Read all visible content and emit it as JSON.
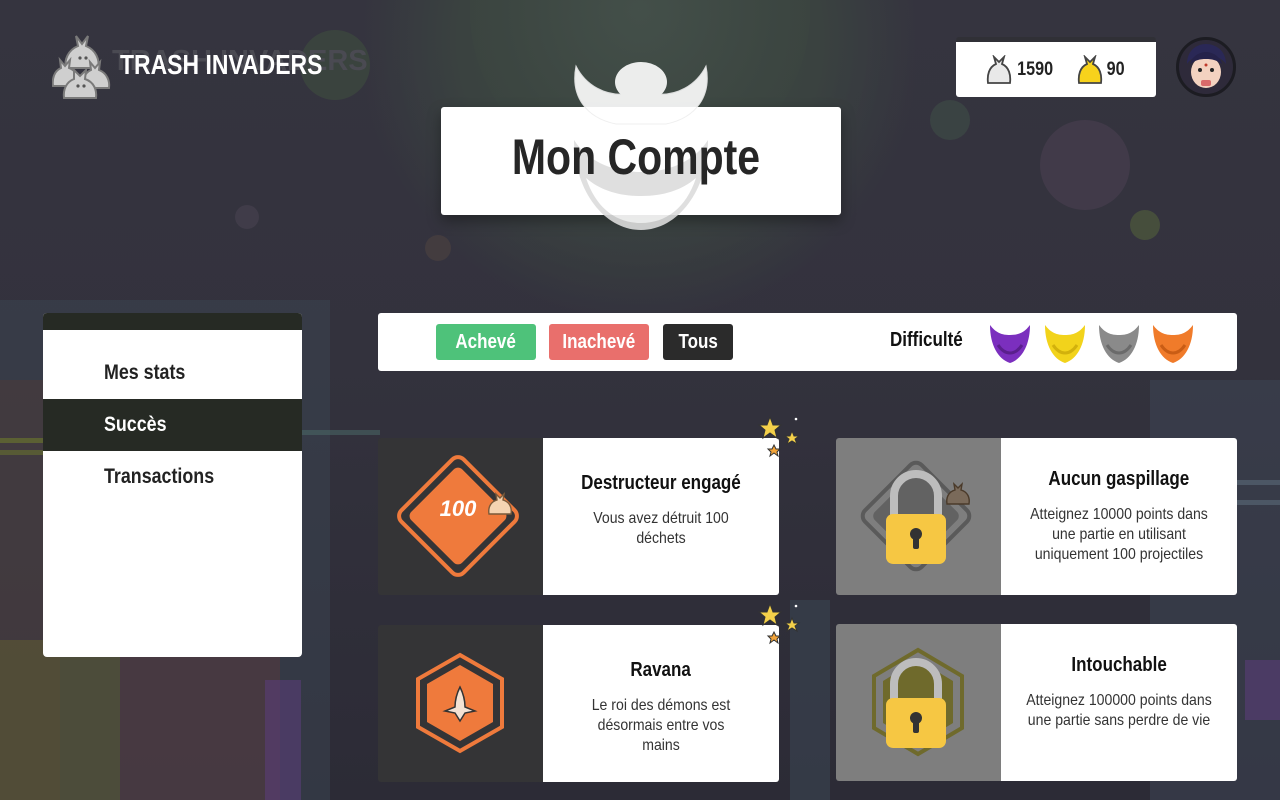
{
  "app": {
    "logo_text": "TRASH INVADERS"
  },
  "wallet": {
    "silver": "1590",
    "gold": "90"
  },
  "page_title": "Mon Compte",
  "sidebar": {
    "items": [
      {
        "label": "Mes stats",
        "active": false
      },
      {
        "label": "Succès",
        "active": true
      },
      {
        "label": "Transactions",
        "active": false
      }
    ]
  },
  "filters": {
    "done": "Achevé",
    "undone": "Inachevé",
    "all": "Tous",
    "difficulty_label": "Difficulté",
    "difficulty_colors": [
      "#7b2fbe",
      "#f2d31b",
      "#8a8a8a",
      "#f07b2a"
    ]
  },
  "colors": {
    "done": "#4ec27a",
    "undone": "#e96f6c",
    "all": "#2b2b2b",
    "accent_orange": "#ef7a3c"
  },
  "achievements": [
    {
      "title": "Destructeur engagé",
      "desc": "Vous avez détruit 100 déchets",
      "badge_text": "100",
      "unlocked": true
    },
    {
      "title": "Aucun gaspillage",
      "desc": "Atteignez 10000 points dans une partie en utilisant uniquement 100 projectiles",
      "badge_text": "",
      "unlocked": false
    },
    {
      "title": "Ravana",
      "desc": "Le roi des démons est désormais entre vos mains",
      "badge_text": "",
      "unlocked": true
    },
    {
      "title": "Intouchable",
      "desc": "Atteignez 100000 points dans une partie sans perdre de vie",
      "badge_text": "",
      "unlocked": false
    }
  ]
}
